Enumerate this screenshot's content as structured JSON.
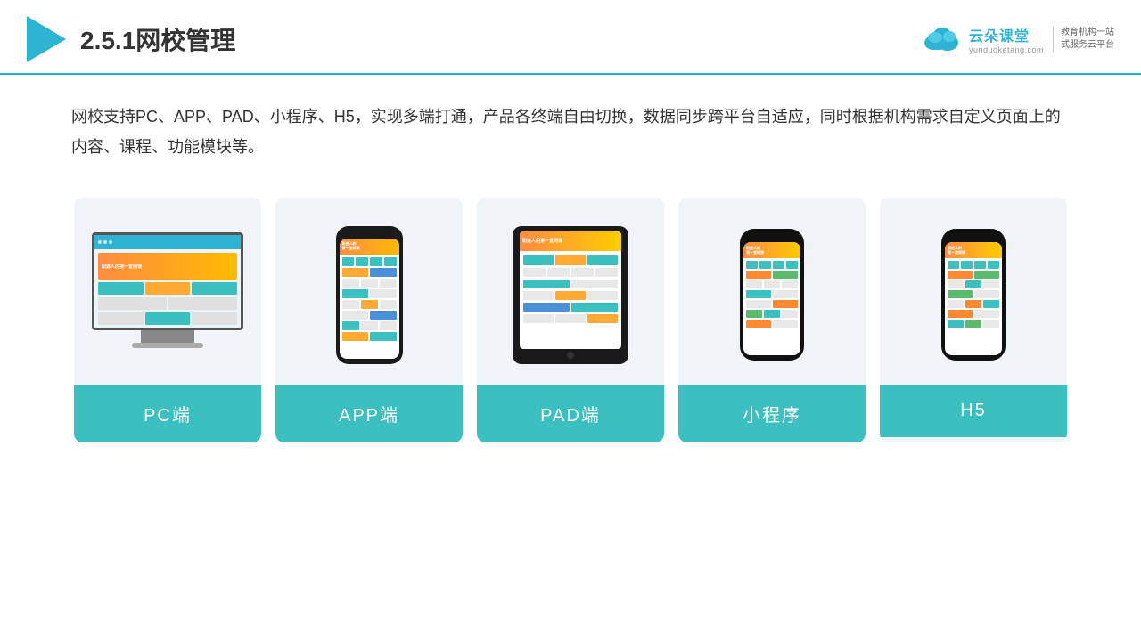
{
  "header": {
    "title": "2.5.1网校管理",
    "brand": {
      "name": "云朵课堂",
      "url": "yunduoketang.com",
      "slogan_line1": "教育机构一站",
      "slogan_line2": "式服务云平台"
    }
  },
  "description": {
    "text": "网校支持PC、APP、PAD、小程序、H5，实现多端打通，产品各终端自由切换，数据同步跨平台自适应，同时根据机构需求自定义页面上的内容、课程、功能模块等。"
  },
  "cards": [
    {
      "id": "pc",
      "label": "PC端"
    },
    {
      "id": "app",
      "label": "APP端"
    },
    {
      "id": "pad",
      "label": "PAD端"
    },
    {
      "id": "miniprogram",
      "label": "小程序"
    },
    {
      "id": "h5",
      "label": "H5"
    }
  ]
}
